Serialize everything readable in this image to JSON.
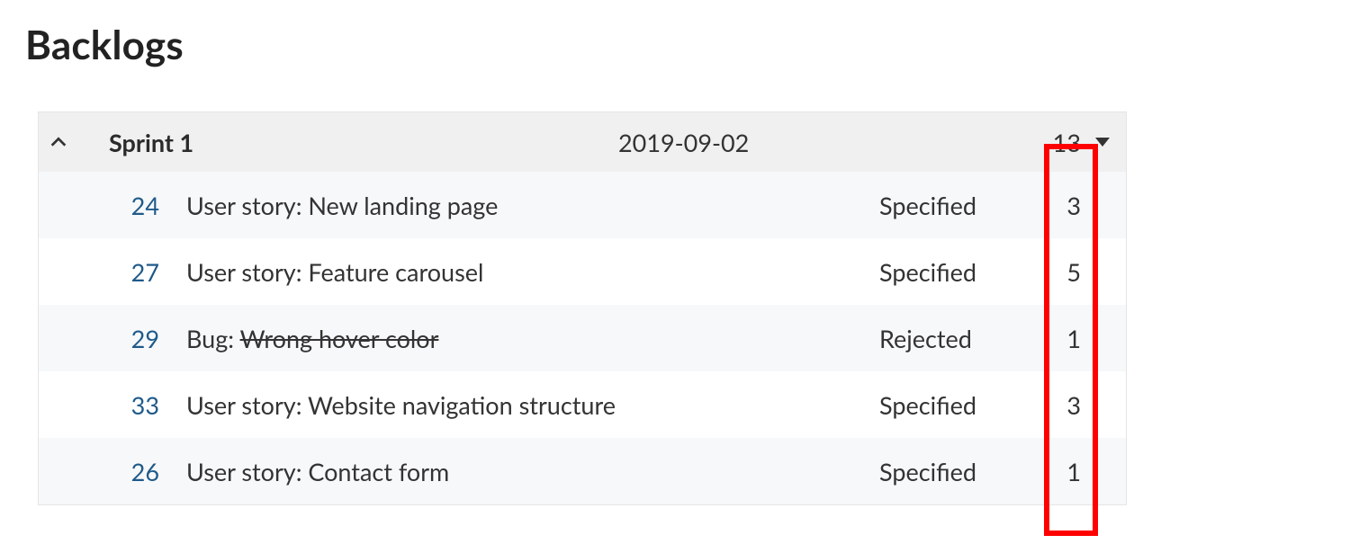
{
  "page": {
    "title": "Backlogs"
  },
  "sprint": {
    "name": "Sprint 1",
    "date": "2019-09-02",
    "total_points": "13"
  },
  "issues": [
    {
      "id": "24",
      "prefix": "User story: ",
      "name": "New landing page",
      "status": "Specified",
      "points": "3",
      "strike": false
    },
    {
      "id": "27",
      "prefix": "User story: ",
      "name": "Feature carousel",
      "status": "Specified",
      "points": "5",
      "strike": false
    },
    {
      "id": "29",
      "prefix": "Bug: ",
      "name": "Wrong hover color",
      "status": "Rejected",
      "points": "1",
      "strike": true
    },
    {
      "id": "33",
      "prefix": "User story: ",
      "name": "Website navigation structure",
      "status": "Specified",
      "points": "3",
      "strike": false
    },
    {
      "id": "26",
      "prefix": "User story: ",
      "name": "Contact form",
      "status": "Specified",
      "points": "1",
      "strike": false
    }
  ]
}
